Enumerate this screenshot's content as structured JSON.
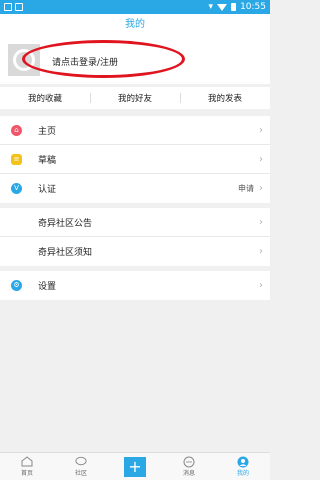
{
  "status_bar": {
    "time": "10:55"
  },
  "title": "我的",
  "profile": {
    "login_text": "请点击登录/注册"
  },
  "tabs": [
    "我的收藏",
    "我的好友",
    "我的发表"
  ],
  "menu": {
    "home": "主页",
    "drafts": "草稿",
    "verify": "认证",
    "verify_extra": "申请",
    "announcement": "奇异社区公告",
    "notice": "奇异社区须知",
    "settings": "设置"
  },
  "bottom_nav": {
    "home": "首页",
    "community": "社区",
    "messages": "消息",
    "me": "我的"
  },
  "colors": {
    "accent": "#2aa8e6",
    "annotation": "#e0141e"
  }
}
